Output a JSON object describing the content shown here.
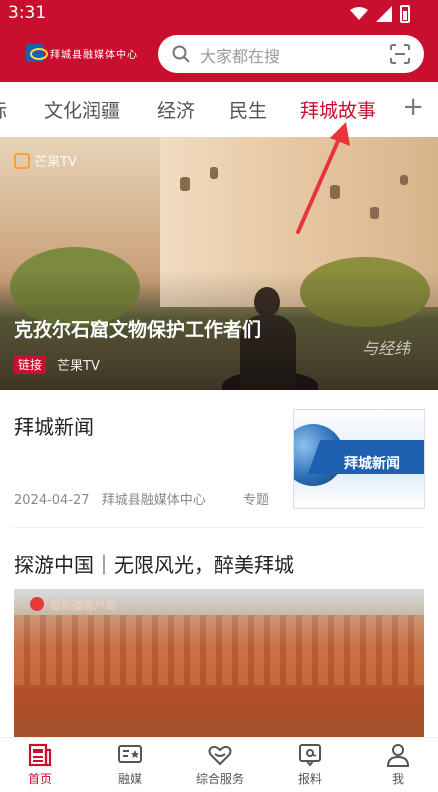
{
  "status_bar": {
    "time": "3:31"
  },
  "header": {
    "logo_text": "拜城县融媒体中心",
    "search_placeholder": "大家都在搜"
  },
  "tabs": [
    {
      "label": "标",
      "active": false
    },
    {
      "label": "文化润疆",
      "active": false
    },
    {
      "label": "经济",
      "active": false
    },
    {
      "label": "民生",
      "active": false
    },
    {
      "label": "拜城故事",
      "active": true
    }
  ],
  "tab_add_symbol": "+",
  "banner": {
    "title": "克孜尔石窟文物保护工作者们",
    "tag": "链接",
    "source": "芒果TV",
    "channel_logo_text": "芒果TV",
    "watermark": "与经纬"
  },
  "news": [
    {
      "title": "拜城新闻",
      "date": "2024-04-27",
      "source": "拜城县融媒体中心",
      "type": "专题",
      "thumb_label": "拜城新闻"
    },
    {
      "title": "探游中国｜无限风光，醉美拜城",
      "image_logo_text": "看新疆客户端"
    }
  ],
  "bottom_nav": [
    {
      "label": "首页",
      "icon": "news-icon",
      "active": true
    },
    {
      "label": "融媒",
      "icon": "media-icon",
      "active": false
    },
    {
      "label": "综合服务",
      "icon": "heart-hands-icon",
      "active": false
    },
    {
      "label": "报料",
      "icon": "report-icon",
      "active": false
    },
    {
      "label": "我",
      "icon": "user-icon",
      "active": false
    }
  ],
  "colors": {
    "brand_red": "#c8102e",
    "text_gray": "#888888"
  }
}
